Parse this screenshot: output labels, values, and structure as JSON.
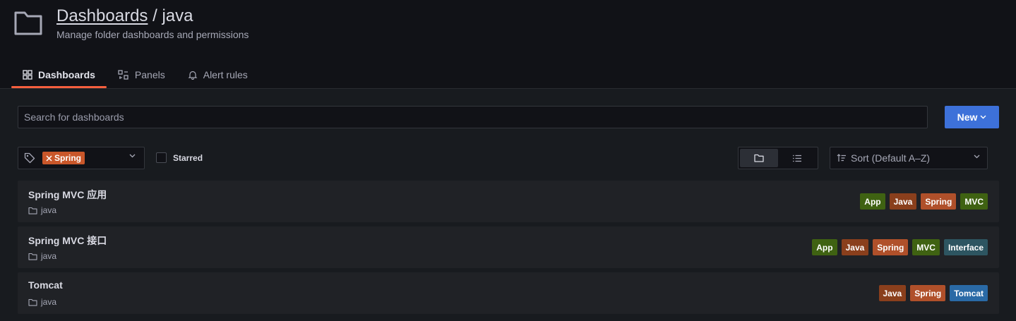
{
  "header": {
    "breadcrumb_parent": "Dashboards",
    "separator": " / ",
    "title": "java",
    "subtitle": "Manage folder dashboards and permissions"
  },
  "tabs": [
    {
      "label": "Dashboards",
      "icon": "apps-icon",
      "active": true
    },
    {
      "label": "Panels",
      "icon": "panels-icon",
      "active": false
    },
    {
      "label": "Alert rules",
      "icon": "bell-icon",
      "active": false
    }
  ],
  "search": {
    "placeholder": "Search for dashboards",
    "value": ""
  },
  "new_button": {
    "label": "New"
  },
  "tag_filter": {
    "selected_tag": "Spring",
    "color": "#c9572a"
  },
  "starred": {
    "label": "Starred",
    "checked": false
  },
  "view_toggle": {
    "active": "folder-view"
  },
  "sort": {
    "label": "Sort (Default A–Z)"
  },
  "rows": [
    {
      "title": "Spring MVC 应用",
      "folder": "java",
      "tags": [
        {
          "label": "App",
          "color": "#3f6212"
        },
        {
          "label": "Java",
          "color": "#8a3f1c"
        },
        {
          "label": "Spring",
          "color": "#b0502a"
        },
        {
          "label": "MVC",
          "color": "#3f6212"
        }
      ]
    },
    {
      "title": "Spring MVC 接口",
      "folder": "java",
      "tags": [
        {
          "label": "App",
          "color": "#3f6212"
        },
        {
          "label": "Java",
          "color": "#8a3f1c"
        },
        {
          "label": "Spring",
          "color": "#b0502a"
        },
        {
          "label": "MVC",
          "color": "#3f6212"
        },
        {
          "label": "Interface",
          "color": "#2d5561"
        }
      ]
    },
    {
      "title": "Tomcat",
      "folder": "java",
      "tags": [
        {
          "label": "Java",
          "color": "#8a3f1c"
        },
        {
          "label": "Spring",
          "color": "#b0502a"
        },
        {
          "label": "Tomcat",
          "color": "#2a6aa6"
        }
      ]
    }
  ]
}
